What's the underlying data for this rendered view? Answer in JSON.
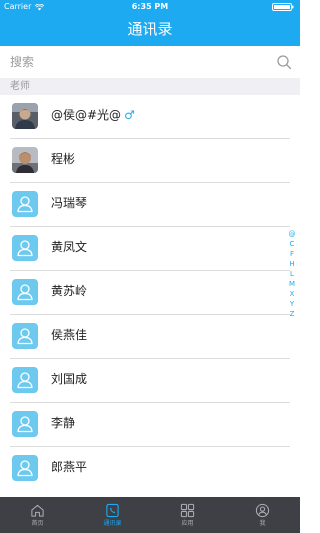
{
  "status_bar": {
    "carrier": "Carrier",
    "time": "6:35 PM"
  },
  "nav": {
    "title": "通讯录"
  },
  "search": {
    "placeholder": "搜索"
  },
  "section": {
    "title": "老师"
  },
  "contacts": [
    {
      "name": "@侯@#光@",
      "gender": "♂",
      "avatar": "photo-avatar"
    },
    {
      "name": "程彬",
      "gender": "",
      "avatar": "photo-avatar"
    },
    {
      "name": "冯瑞琴",
      "gender": "",
      "avatar": "default-user-avatar"
    },
    {
      "name": "黄凤文",
      "gender": "",
      "avatar": "default-user-avatar"
    },
    {
      "name": "黄苏岭",
      "gender": "",
      "avatar": "default-user-avatar"
    },
    {
      "name": "侯燕佳",
      "gender": "",
      "avatar": "default-user-avatar"
    },
    {
      "name": "刘国成",
      "gender": "",
      "avatar": "default-user-avatar"
    },
    {
      "name": "李静",
      "gender": "",
      "avatar": "default-user-avatar"
    },
    {
      "name": "郎燕平",
      "gender": "",
      "avatar": "default-user-avatar"
    }
  ],
  "alpha_index": [
    "@",
    "C",
    "F",
    "H",
    "L",
    "M",
    "X",
    "Y",
    "Z"
  ],
  "tabs": [
    {
      "label": "首页",
      "icon": "home-icon",
      "active": false
    },
    {
      "label": "通讯录",
      "icon": "phone-book-icon",
      "active": true
    },
    {
      "label": "应用",
      "icon": "apps-grid-icon",
      "active": false
    },
    {
      "label": "我",
      "icon": "user-profile-icon",
      "active": false
    }
  ],
  "colors": {
    "accent": "#1daaf0",
    "tabbar": "#3f3f46",
    "avatar_default": "#6ec9ef",
    "section_bg": "#efeff4"
  }
}
